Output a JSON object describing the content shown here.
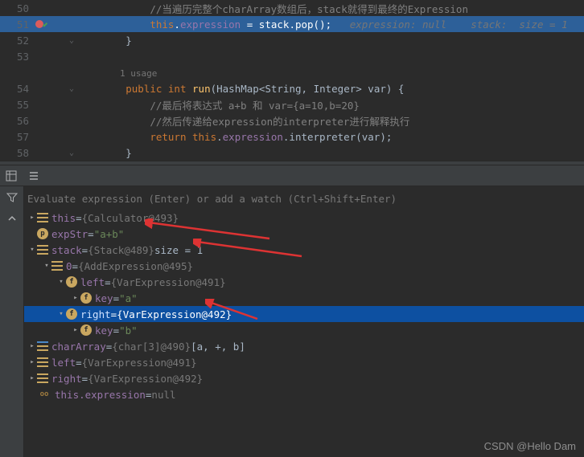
{
  "editor": {
    "lines": [
      {
        "num": "50",
        "cur": false,
        "fold": "",
        "tokens": [
          {
            "t": "            ",
            "c": ""
          },
          {
            "t": "//当遍历完整个charArray数组后，stack就得到最终的Expression",
            "c": "cmt"
          }
        ]
      },
      {
        "num": "51",
        "cur": true,
        "bp": true,
        "fold": "",
        "tokens": [
          {
            "t": "            ",
            "c": ""
          },
          {
            "t": "this",
            "c": "kw"
          },
          {
            "t": ".",
            "c": ""
          },
          {
            "t": "expression",
            "c": "fld"
          },
          {
            "t": " = ",
            "c": ""
          },
          {
            "t": "stack",
            "c": ""
          },
          {
            "t": ".pop();   ",
            "c": ""
          },
          {
            "t": "expression: null    stack:  size = 1",
            "c": "hint"
          }
        ]
      },
      {
        "num": "52",
        "cur": false,
        "fold": "⌄",
        "tokens": [
          {
            "t": "        }",
            "c": ""
          }
        ]
      },
      {
        "num": "53",
        "cur": false,
        "fold": "",
        "tokens": []
      },
      {
        "num": "",
        "cur": false,
        "fold": "",
        "usage": "1 usage"
      },
      {
        "num": "54",
        "cur": false,
        "fold": "⌄",
        "tokens": [
          {
            "t": "        ",
            "c": ""
          },
          {
            "t": "public int",
            "c": "kw"
          },
          {
            "t": " ",
            "c": ""
          },
          {
            "t": "run",
            "c": "method"
          },
          {
            "t": "(",
            "c": ""
          },
          {
            "t": "HashMap",
            "c": "type"
          },
          {
            "t": "<",
            "c": ""
          },
          {
            "t": "String",
            "c": "type"
          },
          {
            "t": ", ",
            "c": ""
          },
          {
            "t": "Integer",
            "c": "type"
          },
          {
            "t": "> var) {",
            "c": ""
          }
        ]
      },
      {
        "num": "55",
        "cur": false,
        "fold": "",
        "tokens": [
          {
            "t": "            ",
            "c": ""
          },
          {
            "t": "//最后将表达式 a+b 和 var={a=10,b=20}",
            "c": "cmt"
          }
        ]
      },
      {
        "num": "56",
        "cur": false,
        "fold": "",
        "tokens": [
          {
            "t": "            ",
            "c": ""
          },
          {
            "t": "//然后传递给expression的interpreter进行解释执行",
            "c": "cmt"
          }
        ]
      },
      {
        "num": "57",
        "cur": false,
        "fold": "",
        "tokens": [
          {
            "t": "            ",
            "c": ""
          },
          {
            "t": "return this",
            "c": "kw"
          },
          {
            "t": ".",
            "c": ""
          },
          {
            "t": "expression",
            "c": "fld"
          },
          {
            "t": ".interpreter(var);",
            "c": ""
          }
        ]
      },
      {
        "num": "58",
        "cur": false,
        "fold": "⌄",
        "tokens": [
          {
            "t": "        }",
            "c": ""
          }
        ]
      }
    ]
  },
  "watchPrompt": "Evaluate expression (Enter) or add a watch (Ctrl+Shift+Enter)",
  "tree": [
    {
      "d": 0,
      "ch": ">",
      "ic": "bars",
      "name": "this",
      "eq": " = ",
      "val": "{Calculator@493}",
      "sel": false
    },
    {
      "d": 0,
      "ch": "",
      "ic": "p",
      "name": "expStr",
      "eq": " = ",
      "valStr": "\"a+b\"",
      "sel": false
    },
    {
      "d": 0,
      "ch": "v",
      "ic": "bars",
      "name": "stack",
      "eq": " = ",
      "val": "{Stack@489}",
      "extra": "  size = 1",
      "sel": false
    },
    {
      "d": 1,
      "ch": "v",
      "ic": "bars",
      "name": "0",
      "eq": " = ",
      "val": "{AddExpression@495}",
      "sel": false
    },
    {
      "d": 2,
      "ch": "v",
      "ic": "f",
      "name": "left",
      "eq": " = ",
      "val": "{VarExpression@491}",
      "sel": false
    },
    {
      "d": 3,
      "ch": ">",
      "ic": "f",
      "name": "key",
      "eq": " = ",
      "valStr": "\"a\"",
      "sel": false
    },
    {
      "d": 2,
      "ch": "v",
      "ic": "f",
      "name": "right",
      "eq": " = ",
      "val": "{VarExpression@492}",
      "sel": true
    },
    {
      "d": 3,
      "ch": ">",
      "ic": "f",
      "name": "key",
      "eq": " = ",
      "valStr": "\"b\"",
      "sel": false
    },
    {
      "d": 0,
      "ch": ">",
      "ic": "barsblue",
      "name": "charArray",
      "eq": " = ",
      "val": "{char[3]@490}",
      "extra": " [a, +, b]",
      "sel": false
    },
    {
      "d": 0,
      "ch": ">",
      "ic": "bars",
      "name": "left",
      "eq": " = ",
      "val": "{VarExpression@491}",
      "sel": false
    },
    {
      "d": 0,
      "ch": ">",
      "ic": "bars",
      "name": "right",
      "eq": " = ",
      "val": "{VarExpression@492}",
      "sel": false
    },
    {
      "d": 0,
      "ch": "",
      "ic": "oo",
      "name": "this.expression",
      "eq": " = ",
      "val": "null",
      "sel": false
    }
  ],
  "watermark": "CSDN @Hello Dam"
}
